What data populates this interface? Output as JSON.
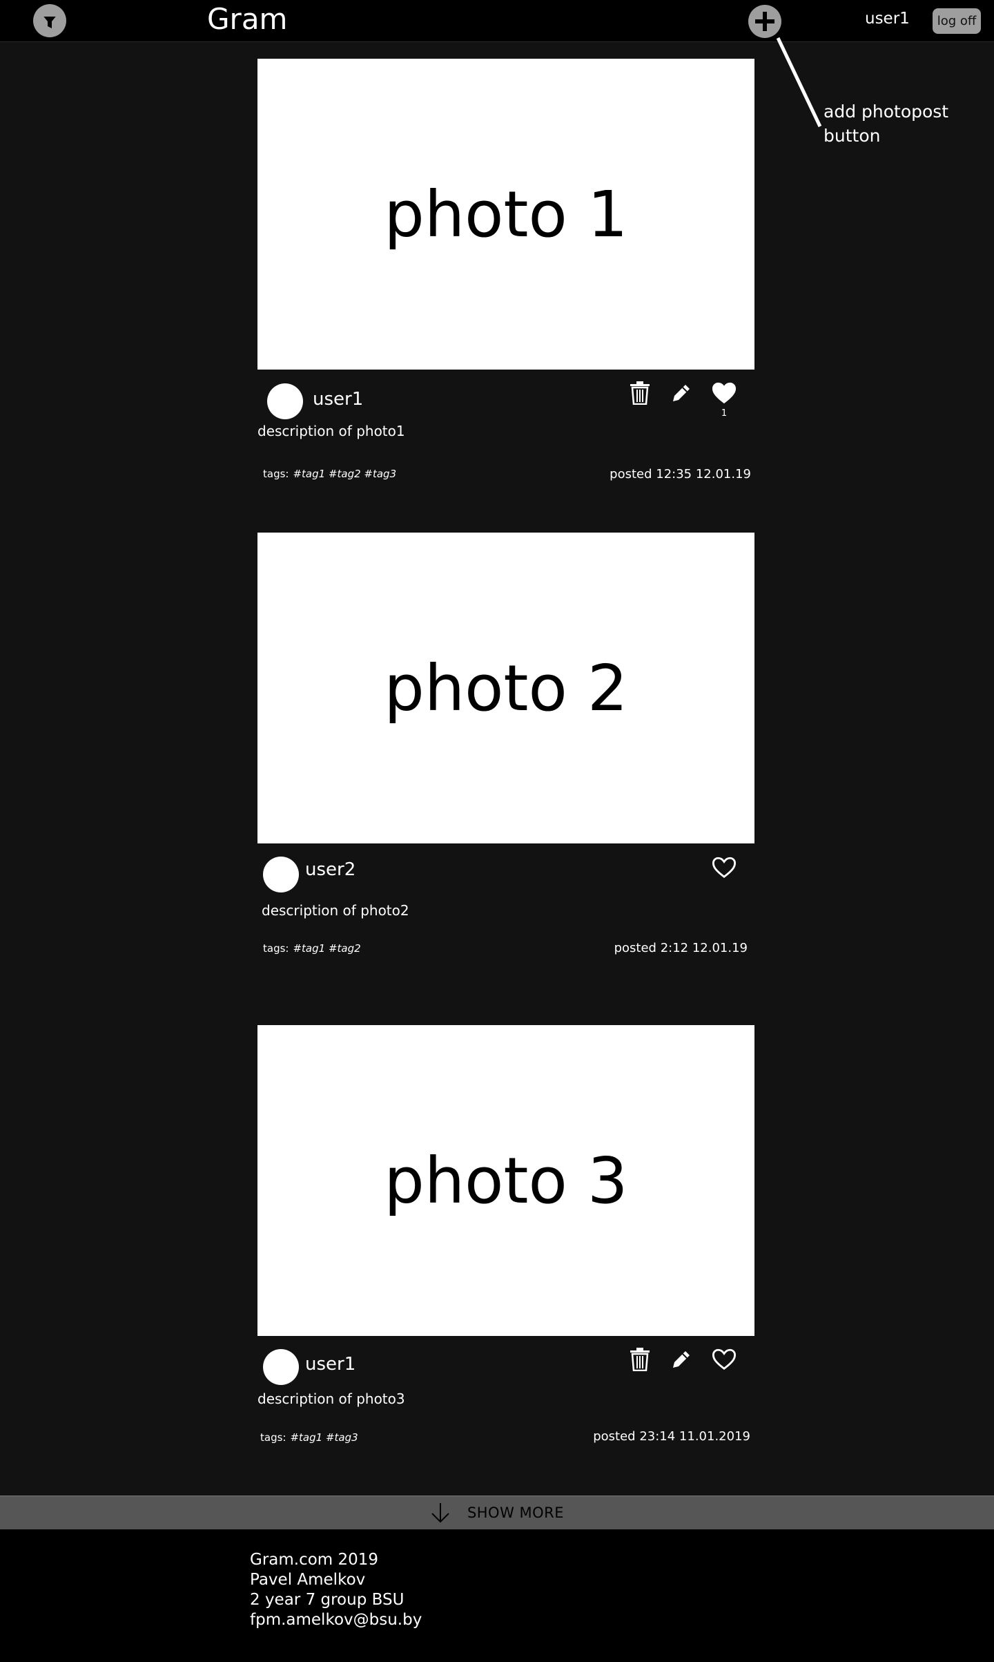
{
  "header": {
    "logo": "Gram",
    "current_user": "user1",
    "logoff_label": "log off",
    "icons": {
      "filter": "filter-icon",
      "add": "plus-circle-icon"
    }
  },
  "annotation": {
    "text": "add photopost button"
  },
  "posts": [
    {
      "photo_label": "photo 1",
      "author": "user1",
      "description": "description of photo1",
      "tags_label": "tags:",
      "tags": "#tag1 #tag2 #tag3",
      "posted": "posted 12:35 12.01.19",
      "likes": "1",
      "liked": true,
      "can_edit": true
    },
    {
      "photo_label": "photo 2",
      "author": "user2",
      "description": "description of photo2",
      "tags_label": "tags:",
      "tags": "#tag1 #tag2",
      "posted": "posted  2:12 12.01.19",
      "liked": false,
      "can_edit": false
    },
    {
      "photo_label": "photo 3",
      "author": "user1",
      "description": "description of photo3",
      "tags_label": "tags:",
      "tags": "#tag1 #tag3",
      "posted": "posted 23:14 11.01.2019",
      "liked": false,
      "can_edit": true
    }
  ],
  "show_more": {
    "label": "SHOW MORE",
    "icon": "arrow-down-icon"
  },
  "footer": {
    "line1": "Gram.com  2019",
    "line2": "Pavel Amelkov",
    "line3": "2 year 7 group BSU",
    "line4": "fpm.amelkov@bsu.by"
  },
  "colors": {
    "background": "#121212",
    "header": "#000000",
    "button_gray": "#9e9e9e",
    "show_more_bar": "#565656"
  }
}
